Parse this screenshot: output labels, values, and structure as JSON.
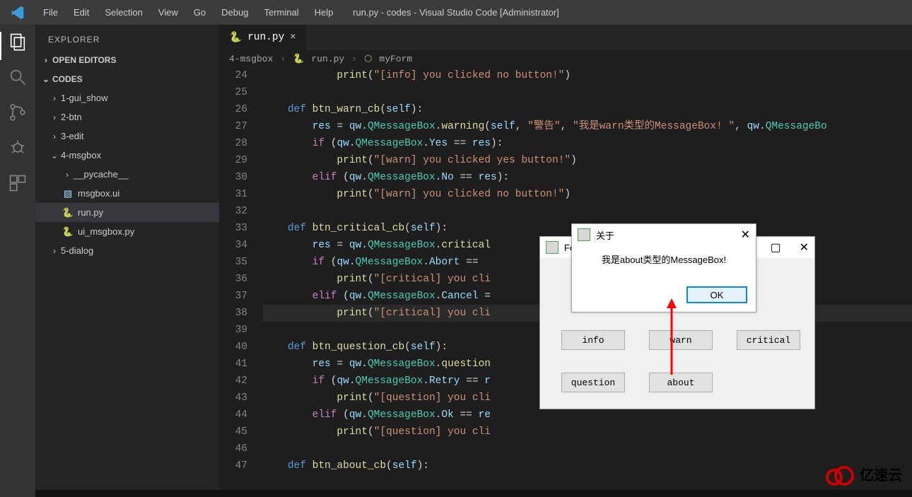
{
  "title": "run.py - codes - Visual Studio Code [Administrator]",
  "menu": [
    "File",
    "Edit",
    "Selection",
    "View",
    "Go",
    "Debug",
    "Terminal",
    "Help"
  ],
  "explorer": {
    "title": "EXPLORER",
    "open_editors": "OPEN EDITORS",
    "root": "CODES",
    "tree": [
      {
        "name": "1-gui_show",
        "kind": "folder",
        "expanded": false,
        "indent": 1
      },
      {
        "name": "2-btn",
        "kind": "folder",
        "expanded": false,
        "indent": 1
      },
      {
        "name": "3-edit",
        "kind": "folder",
        "expanded": false,
        "indent": 1
      },
      {
        "name": "4-msgbox",
        "kind": "folder",
        "expanded": true,
        "indent": 1
      },
      {
        "name": "__pycache__",
        "kind": "folder",
        "expanded": false,
        "indent": 2
      },
      {
        "name": "msgbox.ui",
        "kind": "file",
        "icon": "ui",
        "indent": 2
      },
      {
        "name": "run.py",
        "kind": "file",
        "icon": "py",
        "indent": 2,
        "selected": true
      },
      {
        "name": "ui_msgbox.py",
        "kind": "file",
        "icon": "py",
        "indent": 2
      },
      {
        "name": "5-dialog",
        "kind": "folder",
        "expanded": false,
        "indent": 1
      }
    ]
  },
  "tab": {
    "label": "run.py"
  },
  "breadcrumbs": {
    "folder": "4-msgbox",
    "file": "run.py",
    "symbol": "myForm"
  },
  "line_numbers": [
    24,
    25,
    26,
    27,
    28,
    29,
    30,
    31,
    32,
    33,
    34,
    35,
    36,
    37,
    38,
    39,
    40,
    41,
    42,
    43,
    44,
    45,
    46,
    47
  ],
  "form_window": {
    "title": "Fo",
    "buttons": {
      "info": "info",
      "warn": "warn",
      "critical": "critical",
      "question": "question",
      "about": "about"
    }
  },
  "about_dialog": {
    "title": "关于",
    "message": "我是about类型的MessageBox!",
    "ok": "OK"
  },
  "watermark": "亿速云"
}
